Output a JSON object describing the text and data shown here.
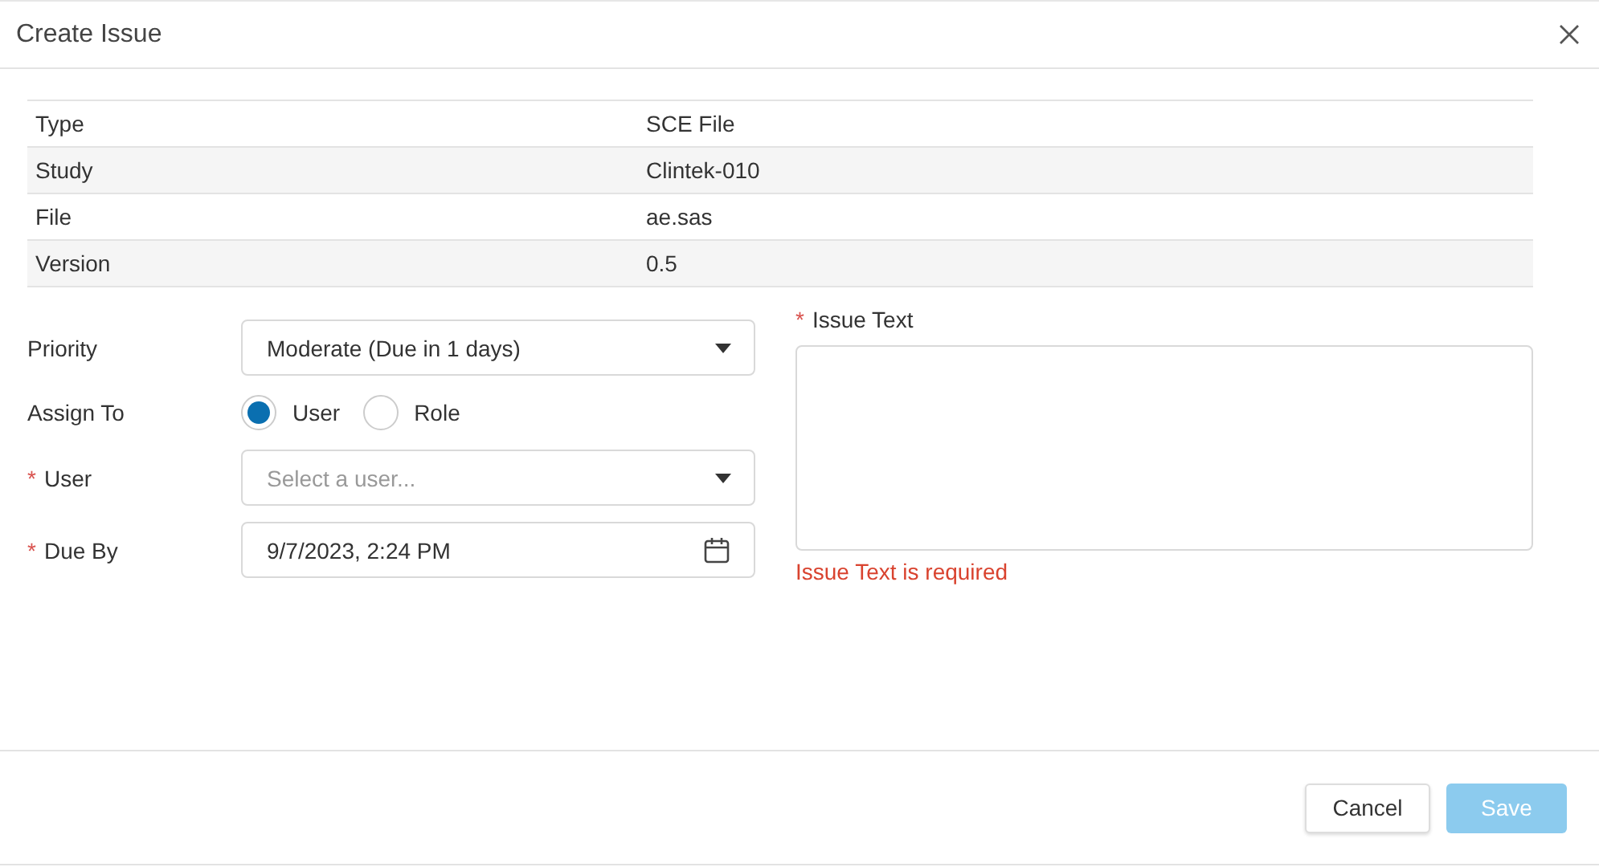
{
  "dialog": {
    "title": "Create Issue"
  },
  "details": [
    {
      "label": "Type",
      "value": "SCE File"
    },
    {
      "label": "Study",
      "value": "Clintek-010"
    },
    {
      "label": "File",
      "value": "ae.sas"
    },
    {
      "label": "Version",
      "value": "0.5"
    }
  ],
  "fields": [
    {
      "kind": "select",
      "label": "Priority",
      "value": "Moderate (Due in 1 days)"
    },
    {
      "kind": "radio",
      "label": "Assign To",
      "options": [
        {
          "label": "User",
          "selected": true
        },
        {
          "label": "Role",
          "selected": false
        }
      ]
    },
    {
      "kind": "select",
      "label": "User",
      "required_mark": "*",
      "placeholder": "Select a user..."
    },
    {
      "kind": "date",
      "label": "Due By",
      "required_mark": "*",
      "value": "9/7/2023, 2:24 PM"
    }
  ],
  "issue_text": {
    "label": "Issue Text",
    "required_mark": "*",
    "error": "Issue Text is required"
  },
  "buttons": [
    {
      "label": "Cancel",
      "kind": "secondary",
      "disabled": false
    },
    {
      "label": "Save",
      "kind": "primary",
      "disabled": true
    }
  ]
}
